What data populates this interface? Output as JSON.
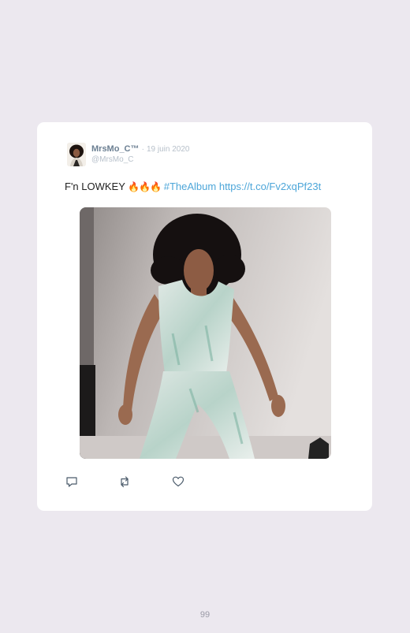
{
  "tweet": {
    "author_name": "MrsMo_C™",
    "date": "19 juin 2020",
    "handle": "@MrsMo_C",
    "text": "F'n LOWKEY",
    "emoji": "🔥🔥🔥",
    "hashtag": "#TheAlbum",
    "link": "https://t.co/Fv2xqPf23t",
    "media_alt": "woman dancing in sparkly outfit"
  },
  "actions": {
    "reply_icon": "reply-icon",
    "retweet_icon": "retweet-icon",
    "like_icon": "heart-icon"
  },
  "page_number": "99"
}
